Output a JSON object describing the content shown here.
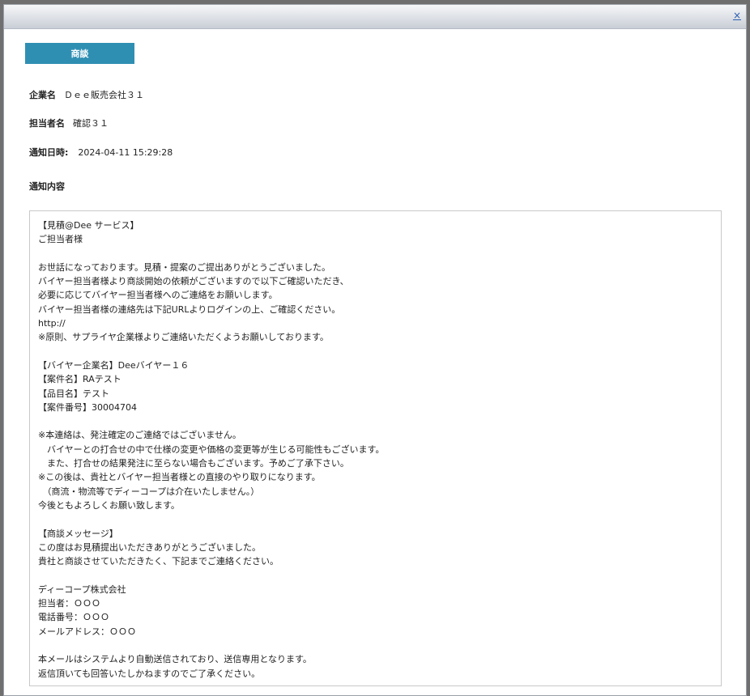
{
  "window": {
    "close_label": "×"
  },
  "tab": {
    "label": "商談"
  },
  "fields": {
    "company_label": "企業名",
    "company_value": "Ｄｅｅ販売会社３１",
    "person_label": "担当者名",
    "person_value": "確認３１",
    "date_label": "通知日時:",
    "date_value": "2024-04-11 15:29:28",
    "content_label": "通知内容"
  },
  "message": {
    "lines": [
      "【見積@Dee サービス】",
      "ご担当者様",
      "",
      "お世話になっております。見積・提案のご提出ありがとうございました。",
      "バイヤー担当者様より商談開始の依頼がございますので以下ご確認いただき、",
      "必要に応じてバイヤー担当者様へのご連絡をお願いします。",
      "バイヤー担当者様の連絡先は下記URLよりログインの上、ご確認ください。",
      "http://",
      "※原則、サプライヤ企業様よりご連絡いただくようお願いしております。",
      "",
      "【バイヤー企業名】Deeバイヤー１６",
      "【案件名】RAテスト",
      "【品目名】テスト",
      "【案件番号】30004704",
      "",
      "※本連絡は、発注確定のご連絡ではございません。",
      "　バイヤーとの打合せの中で仕様の変更や価格の変更等が生じる可能性もございます。",
      "　また、打合せの結果発注に至らない場合もございます。予めご了承下さい。",
      "※この後は、貴社とバイヤー担当者様との直接のやり取りになります。",
      "　（商流・物流等でディーコープは介在いたしません。）",
      "今後ともよろしくお願い致します。",
      "",
      "【商談メッセージ】",
      "この度はお見積提出いただきありがとうございました。",
      "貴社と商談させていただきたく、下記までご連絡ください。",
      "",
      "ディーコープ株式会社",
      "担当者：ＯＯＯ",
      "電話番号：ＯＯＯ",
      "メールアドレス：ＯＯＯ",
      "",
      "本メールはシステムより自動送信されており、送信専用となります。",
      "返信頂いても回答いたしかねますのでご了承ください。"
    ]
  },
  "colors": {
    "tab_bg": "#2f8fb3",
    "link": "#2a5db0"
  }
}
